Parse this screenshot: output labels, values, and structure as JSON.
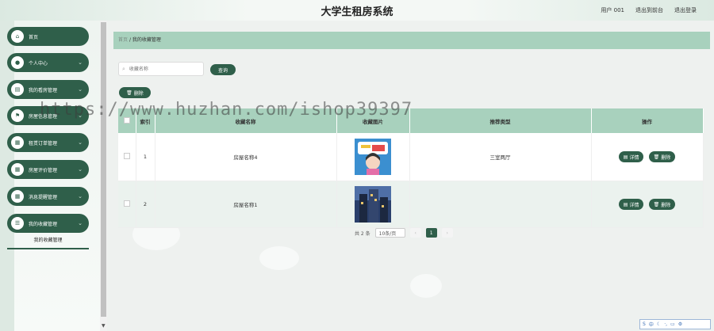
{
  "header": {
    "title": "大学生租房系统",
    "user": "用户 001",
    "back_frontend": "退出到前台",
    "logout": "退出登录"
  },
  "sidebar": {
    "items": [
      {
        "label": "首页",
        "icon": "home-icon",
        "glyph": "⌂",
        "has_chevron": false
      },
      {
        "label": "个人中心",
        "icon": "user-icon",
        "glyph": "●",
        "has_chevron": true
      },
      {
        "label": "我的看房管理",
        "icon": "calendar-icon",
        "glyph": "▤",
        "has_chevron": true
      },
      {
        "label": "房屋信息管理",
        "icon": "flag-icon",
        "glyph": "⚑",
        "has_chevron": true
      },
      {
        "label": "租赁订单管理",
        "icon": "grid-icon",
        "glyph": "▦",
        "has_chevron": true
      },
      {
        "label": "房屋评价管理",
        "icon": "grid-icon",
        "glyph": "▦",
        "has_chevron": true
      },
      {
        "label": "消息提醒管理",
        "icon": "grid-icon",
        "glyph": "▦",
        "has_chevron": true
      },
      {
        "label": "我的收藏管理",
        "icon": "list-icon",
        "glyph": "☰",
        "has_chevron": true
      }
    ],
    "submenu_item": "我的收藏管理"
  },
  "breadcrumb": {
    "home": "首页",
    "separator": "/",
    "current": "我的收藏管理"
  },
  "search": {
    "placeholder": "收藏名称",
    "value": "",
    "button": "查询"
  },
  "toolbar": {
    "delete_label": "删除"
  },
  "table": {
    "columns": [
      "",
      "索引",
      "收藏名称",
      "收藏图片",
      "推荐类型",
      "操作"
    ],
    "rows": [
      {
        "index": "1",
        "name": "房屋名称4",
        "image": "cartoon-image",
        "type": "三室两厅"
      },
      {
        "index": "2",
        "name": "房屋名称1",
        "image": "building-image",
        "type": ""
      }
    ],
    "detail_label": "详情",
    "delete_label": "删除"
  },
  "pagination": {
    "total": "共 2 条",
    "page_size": "10条/页",
    "current_page": "1"
  },
  "watermark": "https://www.huzhan.com/ishop39397",
  "colors": {
    "primary": "#2f5f4a",
    "header_row": "#a8d1bd",
    "row_alt": "#ebf2ee"
  }
}
